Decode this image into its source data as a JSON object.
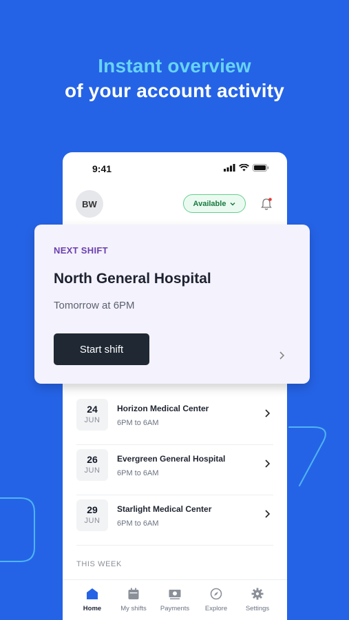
{
  "headline": {
    "line1": "Instant overview",
    "line2": "of your account activity"
  },
  "status_bar": {
    "time": "9:41"
  },
  "header": {
    "avatar_initials": "BW",
    "availability": "Available"
  },
  "next_shift": {
    "label": "NEXT SHIFT",
    "hospital": "North General Hospital",
    "when": "Tomorrow at 6PM",
    "button": "Start shift"
  },
  "shifts": [
    {
      "day": "24",
      "month": "JUN",
      "name": "Horizon Medical Center",
      "hours": "6PM to 6AM"
    },
    {
      "day": "26",
      "month": "JUN",
      "name": "Evergreen General Hospital",
      "hours": "6PM to 6AM"
    },
    {
      "day": "29",
      "month": "JUN",
      "name": "Starlight Medical Center",
      "hours": "6PM to 6AM"
    }
  ],
  "section": {
    "this_week": "THIS WEEK"
  },
  "tabs": [
    {
      "label": "Home",
      "icon": "home-icon",
      "active": true
    },
    {
      "label": "My shifts",
      "icon": "calendar-icon"
    },
    {
      "label": "Payments",
      "icon": "money-icon"
    },
    {
      "label": "Explore",
      "icon": "compass-icon"
    },
    {
      "label": "Settings",
      "icon": "gear-icon"
    }
  ],
  "colors": {
    "background": "#2563e6",
    "headline_accent": "#67d4f5",
    "available_green": "#177a3e",
    "next_shift_purple": "#6b3fb0",
    "button_dark": "#1f2833",
    "notification_dot": "#e53935"
  }
}
